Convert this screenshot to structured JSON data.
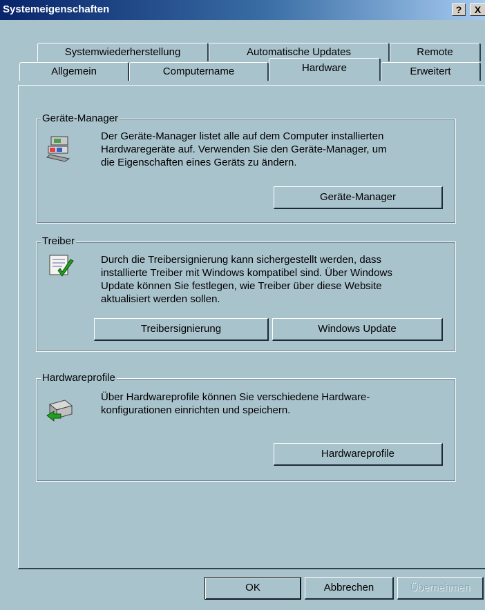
{
  "window": {
    "title": "Systemeigenschaften",
    "help_label": "?",
    "close_label": "X"
  },
  "tabs": {
    "row1": [
      "Systemwiederherstellung",
      "Automatische Updates",
      "Remote"
    ],
    "row2": [
      "Allgemein",
      "Computername",
      "Hardware",
      "Erweitert"
    ],
    "active": "Hardware"
  },
  "device_manager": {
    "title": "Geräte-Manager",
    "description": [
      "Der Geräte-Manager listet alle auf dem Computer installierten",
      "Hardwaregeräte auf. Verwenden Sie den Geräte-Manager, um",
      "die Eigenschaften eines Geräts zu ändern."
    ],
    "button": "Geräte-Manager"
  },
  "drivers": {
    "title": "Treiber",
    "description": [
      "Durch die Treibersignierung kann sichergestellt werden, dass",
      "installierte Treiber mit Windows kompatibel sind. Über Windows",
      "Update können Sie festlegen, wie Treiber über diese Website",
      "aktualisiert werden sollen."
    ],
    "signing_button": "Treibersignierung",
    "update_button": "Windows Update"
  },
  "hardware_profiles": {
    "title": "Hardwareprofile",
    "description": [
      "Über Hardwareprofile können Sie verschiedene Hardware-",
      "konfigurationen einrichten und speichern."
    ],
    "button": "Hardwareprofile"
  },
  "footer": {
    "ok": "OK",
    "cancel": "Abbrechen",
    "apply": "Übernehmen"
  }
}
